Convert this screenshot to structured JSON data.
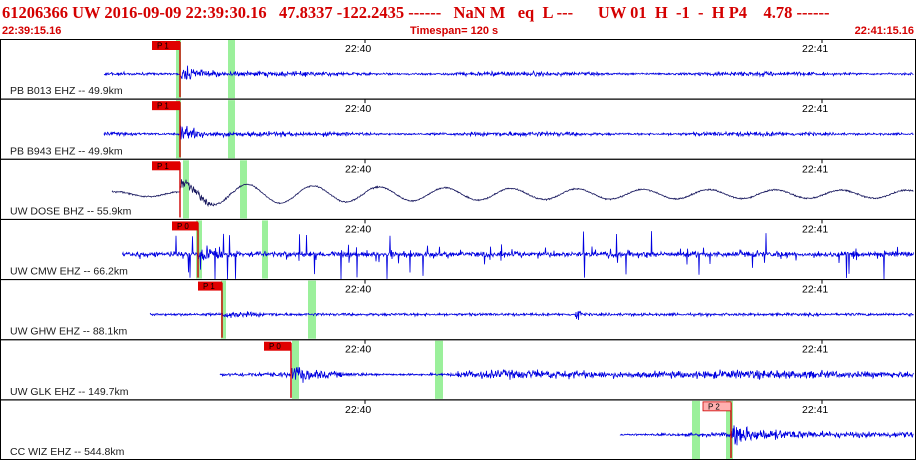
{
  "header": {
    "title": "61206366 UW 2016-09-09 22:39:30.16   47.8337 -122.2435 ------   NaN M   eq  L ---      UW 01  H  -1  -  H P4    4.78 ------",
    "start_time": "22:39:15.16",
    "timespan": "Timespan= 120 s",
    "end_time": "22:41:15.16"
  },
  "minute_ticks": [
    "22:40",
    "22:41"
  ],
  "colors": {
    "trace": "#0000e0",
    "broadband_trace": "#1a1a60",
    "pick_box": "#e00000",
    "pick_box_light": "#ffb0b0",
    "pick_line": "#cc0000",
    "window_marker": "#90ee90",
    "title": "#d40000",
    "border": "#000000"
  },
  "channels": [
    {
      "label": "PB B013 EHZ -- 49.9km",
      "pick": "P 1",
      "pick_style": "red",
      "amplitude": "medium",
      "broadband": false
    },
    {
      "label": "PB B943 EHZ -- 49.9km",
      "pick": "P 1",
      "pick_style": "red",
      "amplitude": "medium",
      "broadband": false
    },
    {
      "label": "UW DOSE BHZ -- 55.9km",
      "pick": "P 1",
      "pick_style": "red",
      "amplitude": "wave",
      "broadband": true
    },
    {
      "label": "UW CMW EHZ -- 66.2km",
      "pick": "P 0",
      "pick_style": "red",
      "amplitude": "large",
      "broadband": false
    },
    {
      "label": "UW GHW EHZ -- 88.1km",
      "pick": "P 1",
      "pick_style": "red",
      "amplitude": "small",
      "broadband": false
    },
    {
      "label": "UW GLK EHZ -- 149.7km",
      "pick": "P 0",
      "pick_style": "red",
      "amplitude": "medium",
      "broadband": false
    },
    {
      "label": "CC WIZ EHZ -- 544.8km",
      "pick": "P 2",
      "pick_style": "light",
      "amplitude": "medium",
      "broadband": false
    }
  ]
}
